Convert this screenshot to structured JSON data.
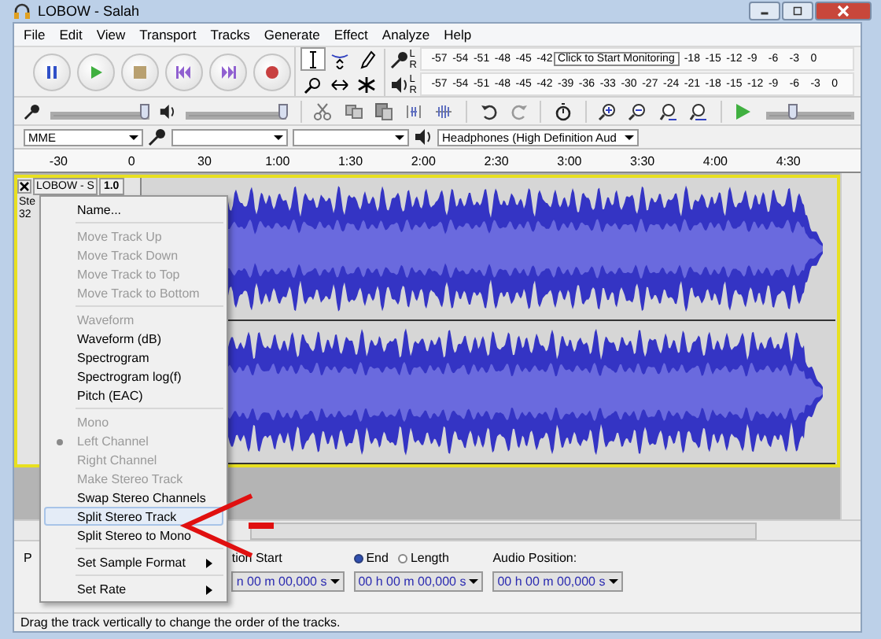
{
  "window": {
    "title": "LOBOW - Salah"
  },
  "menu_bar": [
    "File",
    "Edit",
    "View",
    "Transport",
    "Tracks",
    "Generate",
    "Effect",
    "Analyze",
    "Help"
  ],
  "meters": [
    {
      "kind": "record",
      "channels": [
        "L",
        "R"
      ],
      "ticks_before": [
        "-57",
        "-54",
        "-51",
        "-48",
        "-45",
        "-42"
      ],
      "tooltip": "Click to Start Monitoring",
      "ticks_after": [
        "-18",
        "-15",
        "-12",
        "-9",
        "-6",
        "-3",
        "0"
      ]
    },
    {
      "kind": "playback",
      "channels": [
        "L",
        "R"
      ],
      "ticks_before": [
        "-57",
        "-54",
        "-51",
        "-48",
        "-45",
        "-42",
        "-39",
        "-36",
        "-33",
        "-30",
        "-27",
        "-24",
        "-21",
        "-18",
        "-15",
        "-12",
        "-9",
        "-6",
        "-3",
        "0"
      ]
    }
  ],
  "mixer": {
    "input": {
      "level": 0.95
    },
    "output": {
      "level": 0.97
    }
  },
  "play_at_speed": {
    "level": 0.3
  },
  "devices": {
    "host": "MME",
    "output": "Headphones (High Definition Aud"
  },
  "ruler": [
    "-30",
    "0",
    "30",
    "1:00",
    "1:30",
    "2:00",
    "2:30",
    "3:00",
    "3:30",
    "4:00",
    "4:30"
  ],
  "track": {
    "name": "LOBOW - S",
    "gain": "1.0",
    "info": [
      "Ste",
      "32"
    ],
    "selected": true
  },
  "context_menu": [
    {
      "kind": "item",
      "label": "Name...",
      "disabled": false
    },
    {
      "kind": "separator"
    },
    {
      "kind": "item",
      "label": "Move Track Up",
      "disabled": true
    },
    {
      "kind": "item",
      "label": "Move Track Down",
      "disabled": true
    },
    {
      "kind": "item",
      "label": "Move Track to Top",
      "disabled": true
    },
    {
      "kind": "item",
      "label": "Move Track to Bottom",
      "disabled": true
    },
    {
      "kind": "separator"
    },
    {
      "kind": "item",
      "label": "Waveform",
      "disabled": true
    },
    {
      "kind": "item",
      "label": "Waveform (dB)",
      "disabled": false
    },
    {
      "kind": "item",
      "label": "Spectrogram",
      "disabled": false
    },
    {
      "kind": "item",
      "label": "Spectrogram log(f)",
      "disabled": false
    },
    {
      "kind": "item",
      "label": "Pitch (EAC)",
      "disabled": false
    },
    {
      "kind": "separator"
    },
    {
      "kind": "item",
      "label": "Mono",
      "disabled": true
    },
    {
      "kind": "radio",
      "label": "Left Channel",
      "disabled": true,
      "checked": true
    },
    {
      "kind": "item",
      "label": "Right Channel",
      "disabled": true
    },
    {
      "kind": "item",
      "label": "Make Stereo Track",
      "disabled": true
    },
    {
      "kind": "item",
      "label": "Swap Stereo Channels",
      "disabled": false
    },
    {
      "kind": "item",
      "label": "Split Stereo Track",
      "disabled": false,
      "selected": true
    },
    {
      "kind": "item",
      "label": "Split Stereo to Mono",
      "disabled": false
    },
    {
      "kind": "separator"
    },
    {
      "kind": "submenu",
      "label": "Set Sample Format",
      "disabled": false
    },
    {
      "kind": "separator"
    },
    {
      "kind": "submenu",
      "label": "Set Rate",
      "disabled": false
    }
  ],
  "selection_bar": {
    "rate_label": "P",
    "start_label": "tion Start",
    "start_value": "n 00 m 00,000 s",
    "end_mode": [
      {
        "label": "End",
        "selected": true
      },
      {
        "label": "Length",
        "selected": false
      }
    ],
    "end_value": "00 h 00 m 00,000 s",
    "position_label": "Audio Position:",
    "position_value": "00 h 00 m 00,000 s"
  },
  "status_bar": "Drag the track vertically to change the order of the tracks."
}
